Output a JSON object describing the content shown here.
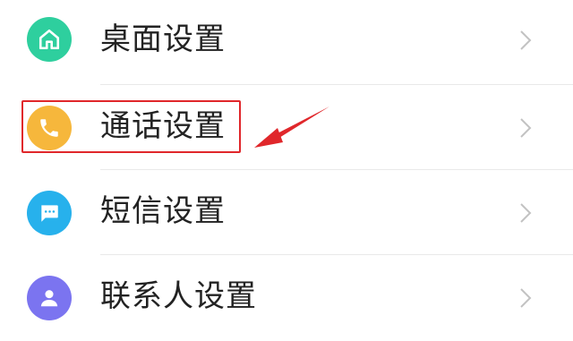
{
  "settings_list": {
    "items": [
      {
        "label": "桌面设置",
        "icon": "home-icon",
        "color": "#2ecf9e"
      },
      {
        "label": "通话设置",
        "icon": "phone-icon",
        "color": "#f6b73c"
      },
      {
        "label": "短信设置",
        "icon": "message-icon",
        "color": "#27b1ec"
      },
      {
        "label": "联系人设置",
        "icon": "contact-icon",
        "color": "#7b74f0"
      }
    ],
    "chevron_icon": "chevron-right-icon",
    "chevron_color": "#c2c2c2"
  },
  "annotation": {
    "highlight_color": "#e0272b",
    "highlighted_item": "通话设置"
  }
}
